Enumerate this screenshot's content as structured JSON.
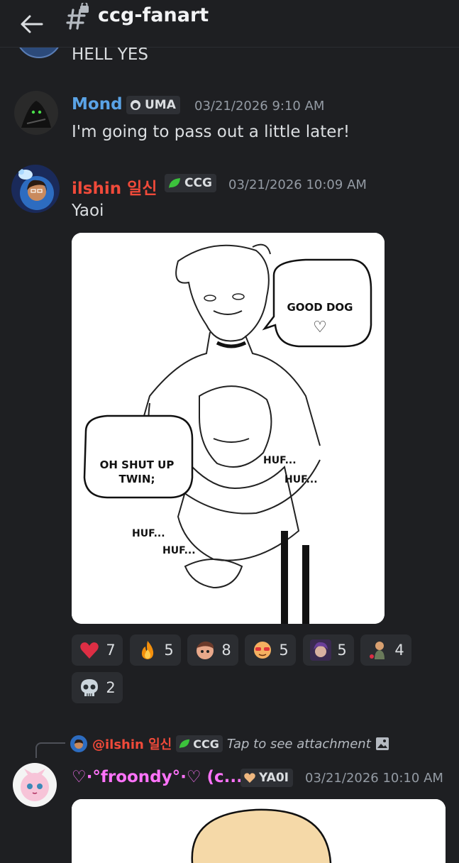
{
  "header": {
    "channel_name": "ccg-fanart"
  },
  "messages": [
    {
      "text": "HELL YES"
    },
    {
      "username": "Mond",
      "username_color": "#5aa3e6",
      "tag": "UMA",
      "timestamp": "03/21/2026 9:10 AM",
      "text": "I'm going to pass out a little later!"
    },
    {
      "username": "ilshin 일신",
      "username_color": "#f04a3a",
      "tag": "CCG",
      "timestamp": "03/21/2026 10:09 AM",
      "text": "Yaoi",
      "attachment": {
        "bubble_top": "GOOD DOG",
        "bubble_heart": "♡",
        "bubble_left_line1": "OH SHUT UP",
        "bubble_left_line2": "TWIN;",
        "huf_a": "HUF...",
        "huf_b": "HUF...",
        "huf_c": "HUF...",
        "huf_d": "HUF..."
      },
      "reactions": [
        {
          "emoji": "heart",
          "count": "7"
        },
        {
          "emoji": "fire",
          "count": "5"
        },
        {
          "emoji": "custom-face-1",
          "count": "8"
        },
        {
          "emoji": "custom-face-glasses",
          "count": "5"
        },
        {
          "emoji": "custom-face-purple",
          "count": "5"
        },
        {
          "emoji": "custom-character",
          "count": "4"
        },
        {
          "emoji": "skull",
          "count": "2"
        }
      ]
    },
    {
      "reply": {
        "mention": "@ilshin 일신",
        "tag": "CCG",
        "text": "Tap to see attachment"
      },
      "username": "♡⋅°froondy°⋅♡ (c...",
      "username_color": "#ff73fa",
      "tag": "YA0I",
      "timestamp": "03/21/2026 10:10 AM"
    }
  ]
}
